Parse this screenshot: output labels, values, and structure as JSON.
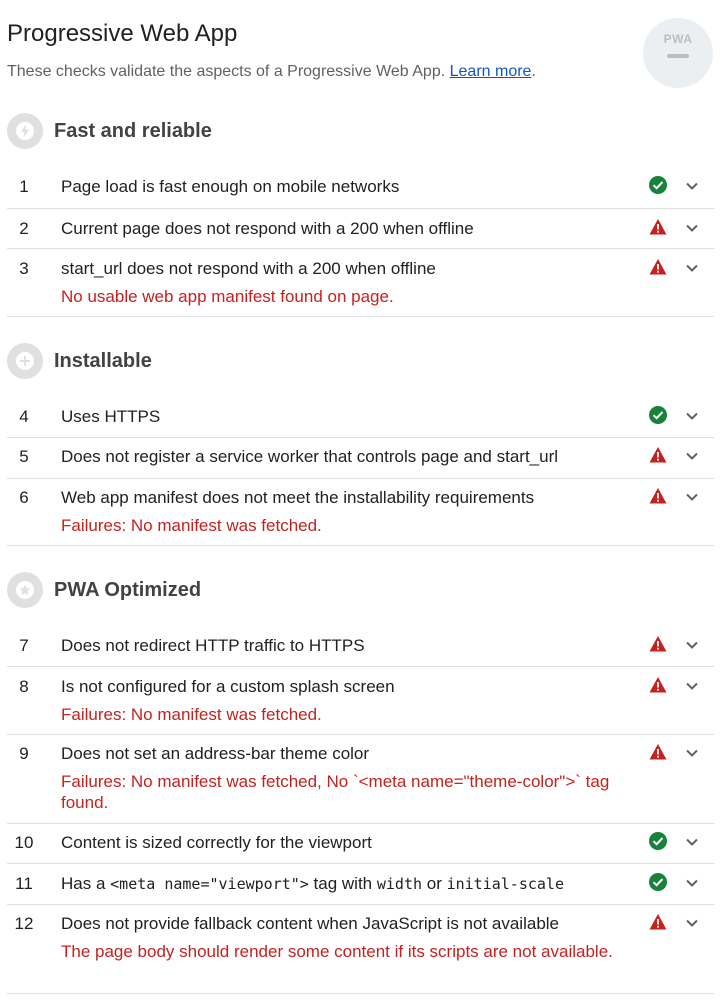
{
  "header": {
    "title": "Progressive Web App",
    "description": "These checks validate the aspects of a Progressive Web App.",
    "learn_more": "Learn more",
    "period": ".",
    "badge_label": "PWA"
  },
  "groups": [
    {
      "title": "Fast and reliable",
      "icon": "lightning-icon",
      "audits": [
        {
          "num": "1",
          "title": "Page load is fast enough on mobile networks",
          "status": "pass"
        },
        {
          "num": "2",
          "title": "Current page does not respond with a 200 when offline",
          "status": "fail"
        },
        {
          "num": "3",
          "title": "start_url does not respond with a 200 when offline",
          "status": "fail",
          "desc": "No usable web app manifest found on page."
        }
      ]
    },
    {
      "title": "Installable",
      "icon": "plus-icon",
      "audits": [
        {
          "num": "4",
          "title": "Uses HTTPS",
          "status": "pass"
        },
        {
          "num": "5",
          "title": "Does not register a service worker that controls page and start_url",
          "status": "fail"
        },
        {
          "num": "6",
          "title": "Web app manifest does not meet the installability requirements",
          "status": "fail",
          "desc": "Failures: No manifest was fetched."
        }
      ]
    },
    {
      "title": "PWA Optimized",
      "icon": "star-icon",
      "audits": [
        {
          "num": "7",
          "title": "Does not redirect HTTP traffic to HTTPS",
          "status": "fail"
        },
        {
          "num": "8",
          "title": "Is not configured for a custom splash screen",
          "status": "fail",
          "desc": "Failures: No manifest was fetched."
        },
        {
          "num": "9",
          "title": "Does not set an address-bar theme color",
          "status": "fail",
          "desc": "Failures: No manifest was fetched, No `<meta name=\"theme-color\">` tag found."
        },
        {
          "num": "10",
          "title": "Content is sized correctly for the viewport",
          "status": "pass"
        },
        {
          "num": "11",
          "title_parts": [
            "Has a ",
            "<meta name=\"viewport\">",
            " tag with ",
            "width",
            " or ",
            "initial-scale"
          ],
          "status": "pass"
        },
        {
          "num": "12",
          "title": "Does not provide fallback content when JavaScript is not available",
          "status": "fail",
          "desc": "The page body should render some content if its scripts are not available."
        }
      ]
    }
  ],
  "colors": {
    "pass": "#178239",
    "fail": "#c5221f",
    "group_icon_bg": "#e0e0e0",
    "link": "#1155cc"
  }
}
